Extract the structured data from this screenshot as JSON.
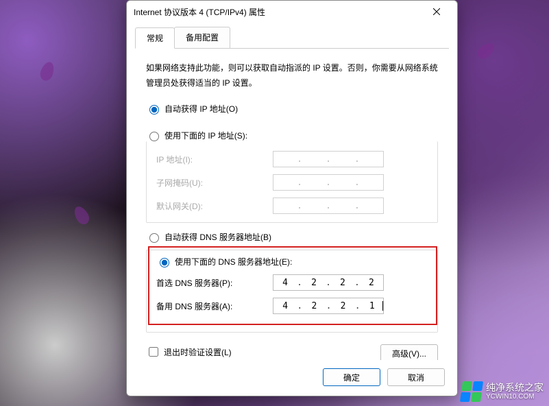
{
  "window": {
    "title": "Internet 协议版本 4 (TCP/IPv4) 属性"
  },
  "tabs": {
    "general": "常规",
    "alternate": "备用配置"
  },
  "description": "如果网络支持此功能，则可以获取自动指派的 IP 设置。否则，你需要从网络系统管理员处获得适当的 IP 设置。",
  "ip_section": {
    "auto_label": "自动获得 IP 地址(O)",
    "manual_label": "使用下面的 IP 地址(S):",
    "ip_address_label": "IP 地址(I):",
    "subnet_label": "子网掩码(U):",
    "gateway_label": "默认网关(D):"
  },
  "dns_section": {
    "auto_label": "自动获得 DNS 服务器地址(B)",
    "manual_label": "使用下面的 DNS 服务器地址(E):",
    "preferred_label": "首选 DNS 服务器(P):",
    "alternate_label": "备用 DNS 服务器(A):",
    "preferred_value": [
      "4",
      "2",
      "2",
      "2"
    ],
    "alternate_value": [
      "4",
      "2",
      "2",
      "1"
    ]
  },
  "validate_label": "退出时验证设置(L)",
  "buttons": {
    "advanced": "高级(V)...",
    "ok": "确定",
    "cancel": "取消"
  },
  "watermark": {
    "name": "纯净系统之家",
    "url": "YCWIN10.COM"
  }
}
